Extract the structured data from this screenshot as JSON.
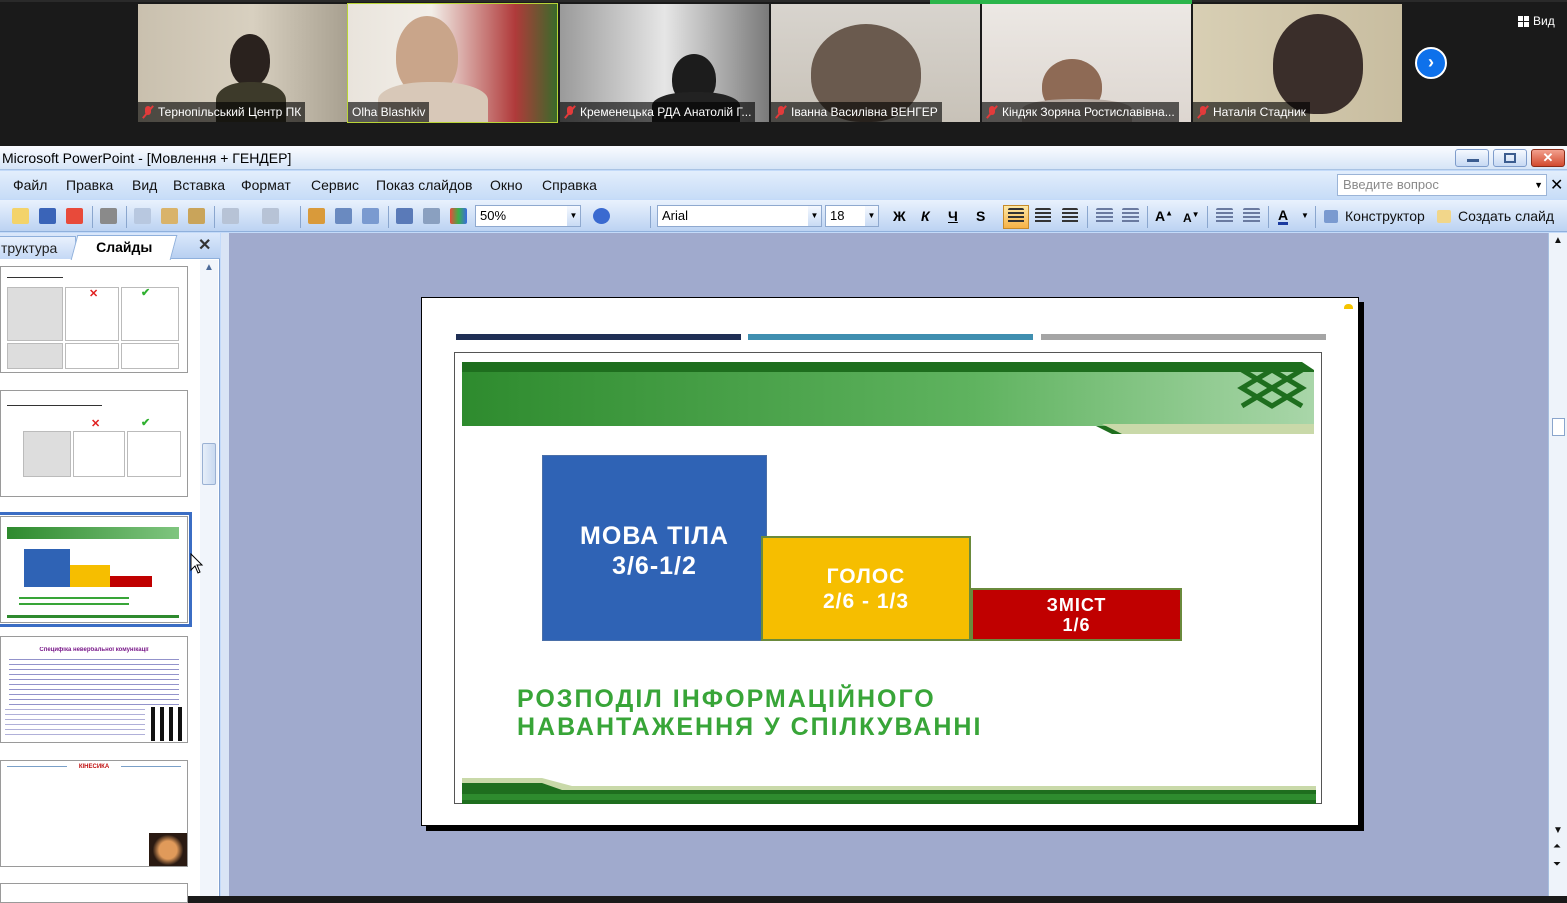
{
  "zoom": {
    "participants": [
      {
        "name": "Тернопільський Центр ПК",
        "muted": true
      },
      {
        "name": "Olha Blashkiv",
        "muted": false,
        "active": true
      },
      {
        "name": "Кременецька РДА Анатолій Г...",
        "muted": true
      },
      {
        "name": "Іванна Василівна ВЕНГЕР",
        "muted": true
      },
      {
        "name": "Кіндяк Зоряна Ростиславівна...",
        "muted": true
      },
      {
        "name": "Наталія Стадник",
        "muted": true
      }
    ],
    "next_icon": "chevron-right-icon",
    "view_label": "Вид"
  },
  "window": {
    "title": "Microsoft PowerPoint - [Мовлення + ГЕНДЕР]"
  },
  "menu": {
    "items": [
      "Файл",
      "Правка",
      "Вид",
      "Вставка",
      "Формат",
      "Сервис",
      "Показ слайдов",
      "Окно",
      "Справка"
    ],
    "help_placeholder": "Введите вопрос"
  },
  "toolbar": {
    "zoom": "50%",
    "font": "Arial",
    "size": "18",
    "bold": "Ж",
    "italic": "К",
    "underline": "Ч",
    "shadow": "S",
    "designer": "Конструктор",
    "new_slide": "Создать слайд"
  },
  "pane": {
    "tab_structure": "труктура",
    "tab_slides": "Слайды",
    "thumb4_title": "Специфіка невербальної комунікації",
    "thumb5_title": "КІНЕСИКА"
  },
  "slide": {
    "block_body_line1": "МОВА ТІЛА",
    "block_body_line2": "3/6-1/2",
    "block_voice_line1": "ГОЛОС",
    "block_voice_line2": "2/6 - 1/3",
    "block_content_line1": "ЗМІСТ",
    "block_content_line2": "1/6",
    "caption_line1": "РОЗПОДІЛ  ІНФОРМАЦІЙНОГО",
    "caption_line2": "НАВАНТАЖЕННЯ У СПІЛКУВАННІ"
  },
  "colors": {
    "zoom_active": "#b9d437",
    "mute_red": "#e23b3b",
    "block_blue": "#2f63b5",
    "block_yellow": "#f6be00",
    "block_red": "#c00000",
    "caption_green": "#38a538",
    "rule_navy": "#1f2f55",
    "rule_teal": "#3f8fb0",
    "rule_gray": "#a5a5a5"
  }
}
